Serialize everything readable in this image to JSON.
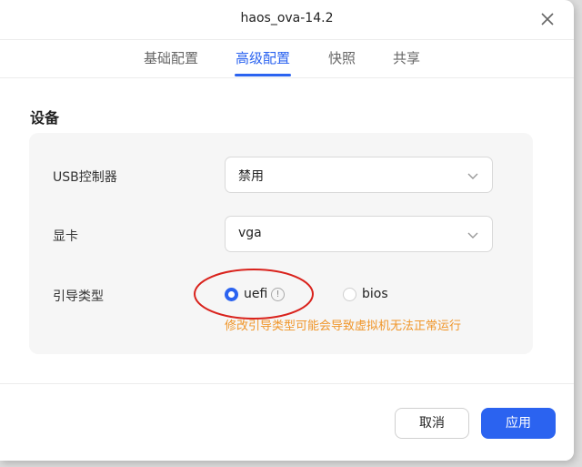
{
  "dialog": {
    "title": "haos_ova-14.2"
  },
  "tabs": [
    {
      "label": "基础配置",
      "active": false
    },
    {
      "label": "高级配置",
      "active": true
    },
    {
      "label": "快照",
      "active": false
    },
    {
      "label": "共享",
      "active": false
    }
  ],
  "section": {
    "title": "设备",
    "usb_label": "USB控制器",
    "usb_value": "禁用",
    "gpu_label": "显卡",
    "gpu_value": "vga",
    "boot_label": "引导类型",
    "boot_options": [
      {
        "label": "uefi",
        "checked": true
      },
      {
        "label": "bios",
        "checked": false
      }
    ],
    "boot_warning": "修改引导类型可能会导致虚拟机无法正常运行"
  },
  "footer": {
    "cancel_label": "取消",
    "apply_label": "应用"
  },
  "colors": {
    "accent": "#2b63f0",
    "warning": "#f0962a",
    "annotation": "#d9221c"
  }
}
